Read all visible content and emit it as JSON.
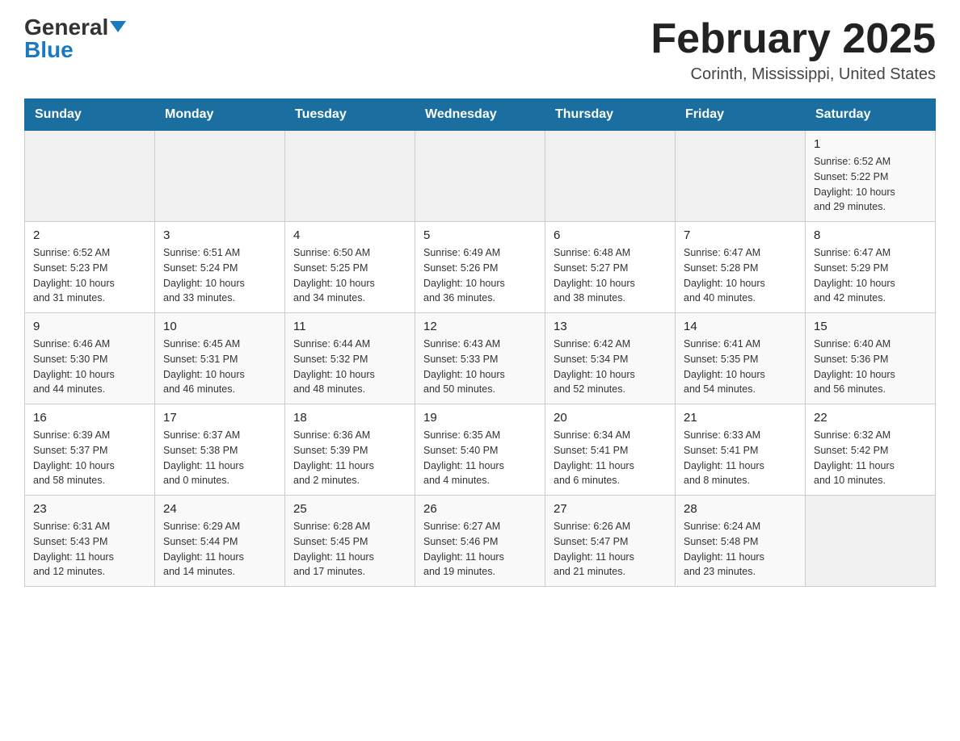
{
  "header": {
    "logo_general": "General",
    "logo_blue": "Blue",
    "title": "February 2025",
    "subtitle": "Corinth, Mississippi, United States"
  },
  "days_of_week": [
    "Sunday",
    "Monday",
    "Tuesday",
    "Wednesday",
    "Thursday",
    "Friday",
    "Saturday"
  ],
  "weeks": [
    {
      "days": [
        {
          "num": "",
          "info": ""
        },
        {
          "num": "",
          "info": ""
        },
        {
          "num": "",
          "info": ""
        },
        {
          "num": "",
          "info": ""
        },
        {
          "num": "",
          "info": ""
        },
        {
          "num": "",
          "info": ""
        },
        {
          "num": "1",
          "info": "Sunrise: 6:52 AM\nSunset: 5:22 PM\nDaylight: 10 hours\nand 29 minutes."
        }
      ]
    },
    {
      "days": [
        {
          "num": "2",
          "info": "Sunrise: 6:52 AM\nSunset: 5:23 PM\nDaylight: 10 hours\nand 31 minutes."
        },
        {
          "num": "3",
          "info": "Sunrise: 6:51 AM\nSunset: 5:24 PM\nDaylight: 10 hours\nand 33 minutes."
        },
        {
          "num": "4",
          "info": "Sunrise: 6:50 AM\nSunset: 5:25 PM\nDaylight: 10 hours\nand 34 minutes."
        },
        {
          "num": "5",
          "info": "Sunrise: 6:49 AM\nSunset: 5:26 PM\nDaylight: 10 hours\nand 36 minutes."
        },
        {
          "num": "6",
          "info": "Sunrise: 6:48 AM\nSunset: 5:27 PM\nDaylight: 10 hours\nand 38 minutes."
        },
        {
          "num": "7",
          "info": "Sunrise: 6:47 AM\nSunset: 5:28 PM\nDaylight: 10 hours\nand 40 minutes."
        },
        {
          "num": "8",
          "info": "Sunrise: 6:47 AM\nSunset: 5:29 PM\nDaylight: 10 hours\nand 42 minutes."
        }
      ]
    },
    {
      "days": [
        {
          "num": "9",
          "info": "Sunrise: 6:46 AM\nSunset: 5:30 PM\nDaylight: 10 hours\nand 44 minutes."
        },
        {
          "num": "10",
          "info": "Sunrise: 6:45 AM\nSunset: 5:31 PM\nDaylight: 10 hours\nand 46 minutes."
        },
        {
          "num": "11",
          "info": "Sunrise: 6:44 AM\nSunset: 5:32 PM\nDaylight: 10 hours\nand 48 minutes."
        },
        {
          "num": "12",
          "info": "Sunrise: 6:43 AM\nSunset: 5:33 PM\nDaylight: 10 hours\nand 50 minutes."
        },
        {
          "num": "13",
          "info": "Sunrise: 6:42 AM\nSunset: 5:34 PM\nDaylight: 10 hours\nand 52 minutes."
        },
        {
          "num": "14",
          "info": "Sunrise: 6:41 AM\nSunset: 5:35 PM\nDaylight: 10 hours\nand 54 minutes."
        },
        {
          "num": "15",
          "info": "Sunrise: 6:40 AM\nSunset: 5:36 PM\nDaylight: 10 hours\nand 56 minutes."
        }
      ]
    },
    {
      "days": [
        {
          "num": "16",
          "info": "Sunrise: 6:39 AM\nSunset: 5:37 PM\nDaylight: 10 hours\nand 58 minutes."
        },
        {
          "num": "17",
          "info": "Sunrise: 6:37 AM\nSunset: 5:38 PM\nDaylight: 11 hours\nand 0 minutes."
        },
        {
          "num": "18",
          "info": "Sunrise: 6:36 AM\nSunset: 5:39 PM\nDaylight: 11 hours\nand 2 minutes."
        },
        {
          "num": "19",
          "info": "Sunrise: 6:35 AM\nSunset: 5:40 PM\nDaylight: 11 hours\nand 4 minutes."
        },
        {
          "num": "20",
          "info": "Sunrise: 6:34 AM\nSunset: 5:41 PM\nDaylight: 11 hours\nand 6 minutes."
        },
        {
          "num": "21",
          "info": "Sunrise: 6:33 AM\nSunset: 5:41 PM\nDaylight: 11 hours\nand 8 minutes."
        },
        {
          "num": "22",
          "info": "Sunrise: 6:32 AM\nSunset: 5:42 PM\nDaylight: 11 hours\nand 10 minutes."
        }
      ]
    },
    {
      "days": [
        {
          "num": "23",
          "info": "Sunrise: 6:31 AM\nSunset: 5:43 PM\nDaylight: 11 hours\nand 12 minutes."
        },
        {
          "num": "24",
          "info": "Sunrise: 6:29 AM\nSunset: 5:44 PM\nDaylight: 11 hours\nand 14 minutes."
        },
        {
          "num": "25",
          "info": "Sunrise: 6:28 AM\nSunset: 5:45 PM\nDaylight: 11 hours\nand 17 minutes."
        },
        {
          "num": "26",
          "info": "Sunrise: 6:27 AM\nSunset: 5:46 PM\nDaylight: 11 hours\nand 19 minutes."
        },
        {
          "num": "27",
          "info": "Sunrise: 6:26 AM\nSunset: 5:47 PM\nDaylight: 11 hours\nand 21 minutes."
        },
        {
          "num": "28",
          "info": "Sunrise: 6:24 AM\nSunset: 5:48 PM\nDaylight: 11 hours\nand 23 minutes."
        },
        {
          "num": "",
          "info": ""
        }
      ]
    }
  ]
}
